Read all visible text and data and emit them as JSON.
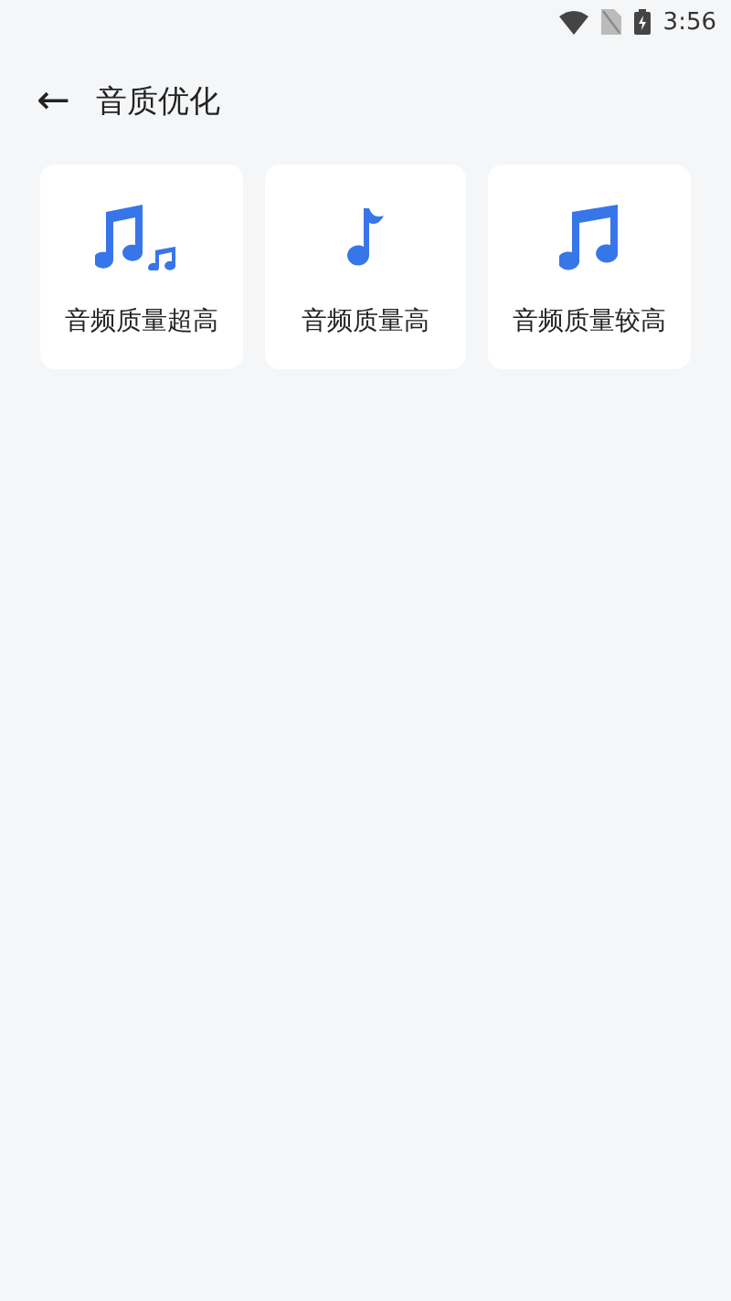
{
  "status_bar": {
    "time": "3:56"
  },
  "header": {
    "back_icon": "←",
    "title": "音质优化"
  },
  "options": [
    {
      "kind": "ultra",
      "label": "音频质量超高"
    },
    {
      "kind": "single",
      "label": "音频质量高"
    },
    {
      "kind": "double",
      "label": "音频质量较高"
    }
  ]
}
